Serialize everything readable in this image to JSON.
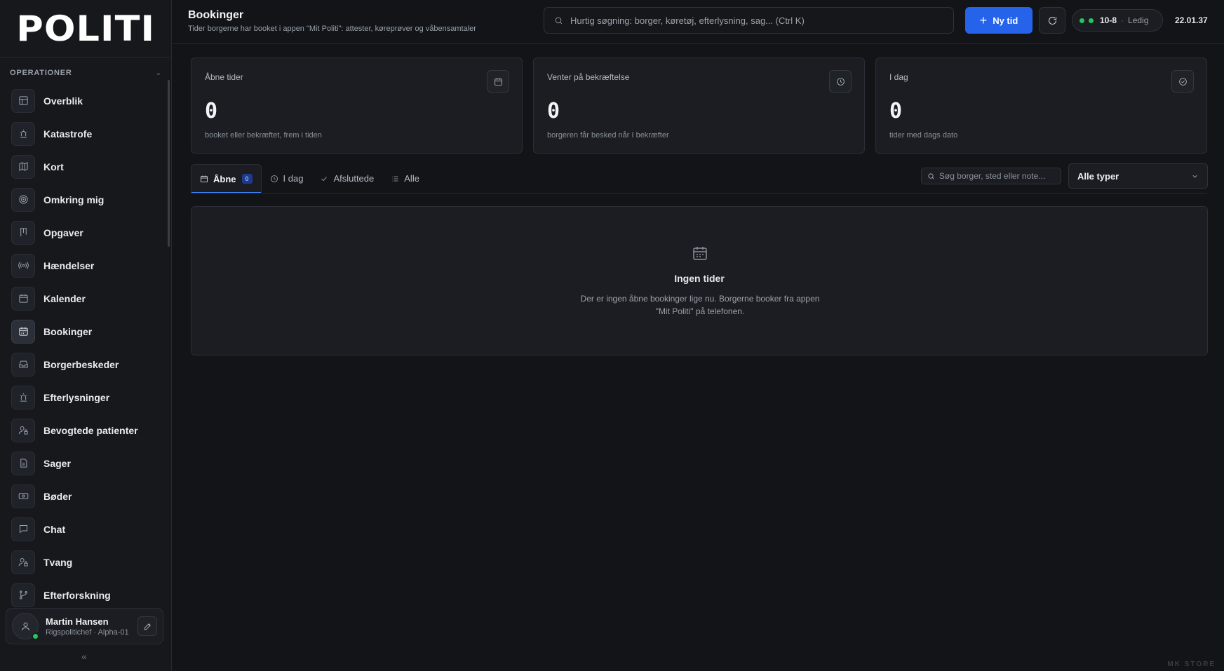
{
  "brand": {
    "logo_text": "POLITI"
  },
  "sidebar": {
    "section_label": "OPERATIONER",
    "items": [
      {
        "label": "Overblik",
        "icon": "layout-icon"
      },
      {
        "label": "Katastrofe",
        "icon": "siren-icon"
      },
      {
        "label": "Kort",
        "icon": "map-icon"
      },
      {
        "label": "Omkring mig",
        "icon": "radar-icon"
      },
      {
        "label": "Opgaver",
        "icon": "kanban-icon"
      },
      {
        "label": "Hændelser",
        "icon": "broadcast-icon"
      },
      {
        "label": "Kalender",
        "icon": "calendar-icon"
      },
      {
        "label": "Bookinger",
        "icon": "calendar-days-icon",
        "active": true
      },
      {
        "label": "Borgerbeskeder",
        "icon": "inbox-icon"
      },
      {
        "label": "Efterlysninger",
        "icon": "siren-icon"
      },
      {
        "label": "Bevogtede patienter",
        "icon": "user-lock-icon"
      },
      {
        "label": "Sager",
        "icon": "file-icon"
      },
      {
        "label": "Bøder",
        "icon": "banknote-icon"
      },
      {
        "label": "Chat",
        "icon": "chat-icon"
      },
      {
        "label": "Tvang",
        "icon": "user-lock-icon"
      },
      {
        "label": "Efterforskning",
        "icon": "branch-icon"
      }
    ],
    "user": {
      "name": "Martin Hansen",
      "role": "Rigspolitichef · Alpha-01",
      "online": true
    },
    "collapse_glyph": "«"
  },
  "header": {
    "title": "Bookinger",
    "subtitle": "Tider borgerne har booket i appen \"Mit Politi\": attester, køreprøver og våbensamtaler",
    "search_placeholder": "Hurtig søgning: borger, køretøj, efterlysning, sag... (Ctrl K)",
    "new_button": "Ny tid",
    "status": {
      "code": "10-8",
      "sep": "·",
      "state": "Ledig"
    },
    "clock": "22.01.37"
  },
  "stats": [
    {
      "title": "Åbne tider",
      "value": "0",
      "note": "booket eller bekræftet, frem i tiden",
      "icon": "calendar-icon"
    },
    {
      "title": "Venter på bekræftelse",
      "value": "0",
      "note": "borgeren får besked når I bekræfter",
      "icon": "clock-icon"
    },
    {
      "title": "I dag",
      "value": "0",
      "note": "tider med dags dato",
      "icon": "check-circle-icon"
    }
  ],
  "tabs": [
    {
      "label": "Åbne",
      "badge": "0",
      "active": true
    },
    {
      "label": "I dag"
    },
    {
      "label": "Afsluttede"
    },
    {
      "label": "Alle"
    }
  ],
  "filter": {
    "search_placeholder": "Søg borger, sted eller note...",
    "type_selected": "Alle typer"
  },
  "empty_state": {
    "title": "Ingen tider",
    "text": "Der er ingen åbne bookinger lige nu. Borgerne booker fra appen \"Mit Politi\" på telefonen."
  },
  "watermark": "MK STORE",
  "colors": {
    "accent": "#2563eb",
    "online": "#22c55e",
    "background": "#121418",
    "panel": "#1b1d22"
  }
}
